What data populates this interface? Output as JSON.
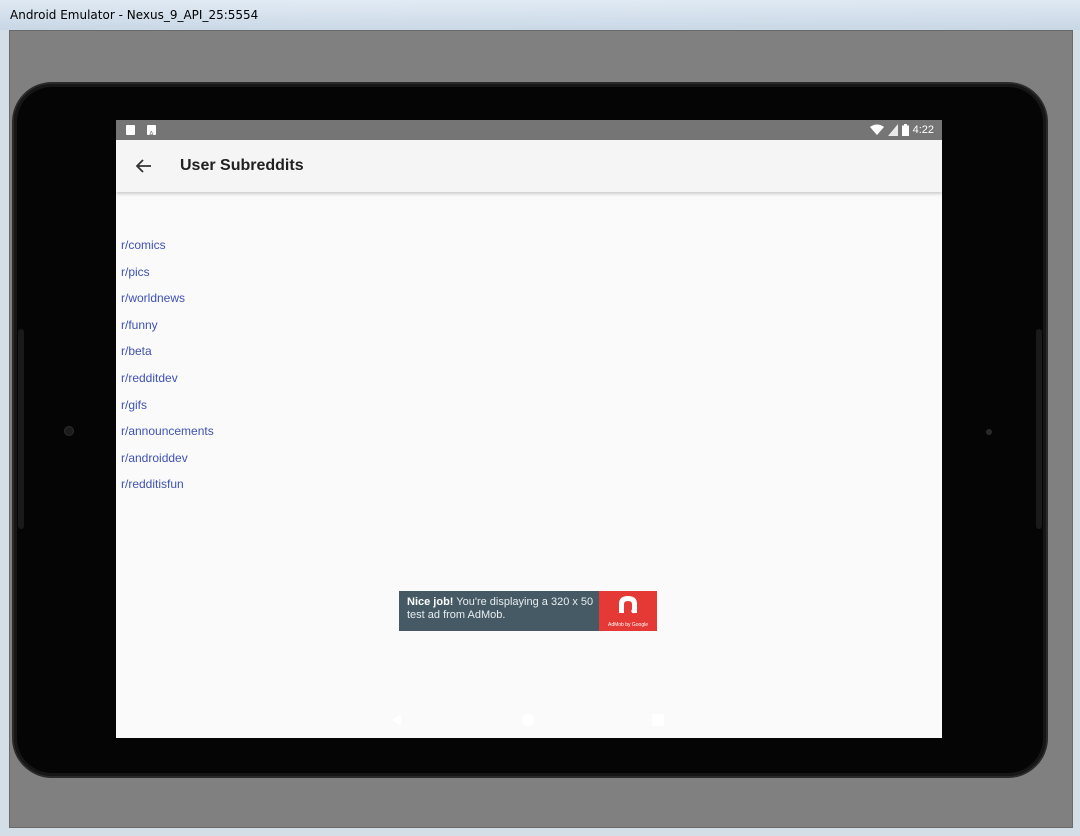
{
  "window": {
    "title": "Android Emulator - Nexus_9_API_25:5554"
  },
  "status_bar": {
    "time": "4:22",
    "left_icons": [
      "sd-card-icon",
      "a-notification-icon"
    ],
    "right_icons": [
      "wifi-icon",
      "signal-icon",
      "battery-icon"
    ]
  },
  "app_bar": {
    "back_icon": "arrow-back-icon",
    "title": "User Subreddits"
  },
  "subreddits": [
    "r/comics",
    "r/pics",
    "r/worldnews",
    "r/funny",
    "r/beta",
    "r/redditdev",
    "r/gifs",
    "r/announcements",
    "r/androiddev",
    "r/redditisfun"
  ],
  "ad": {
    "headline": "Nice job!",
    "body": " You're displaying a 320 x 50 test ad from AdMob.",
    "logo_caption": "AdMob by Google",
    "bg_color": "#455a64",
    "logo_color": "#e53935"
  },
  "nav_bar": {
    "back_icon": "nav-back-icon",
    "home_icon": "nav-home-icon",
    "recents_icon": "nav-recents-icon"
  },
  "colors": {
    "link": "#3f51b5",
    "status_bar": "#757575",
    "app_bar": "#f5f5f5"
  }
}
